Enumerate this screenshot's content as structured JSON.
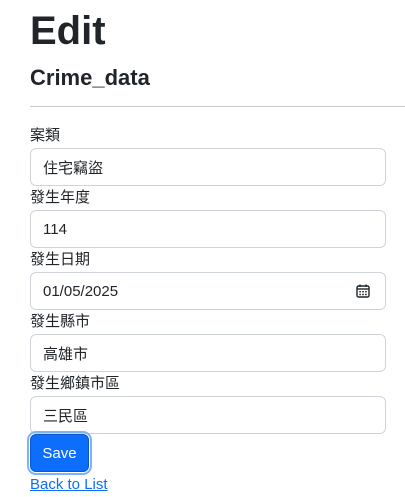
{
  "header": {
    "title": "Edit",
    "subtitle": "Crime_data"
  },
  "form": {
    "fields": [
      {
        "label": "案類",
        "value": "住宅竊盜"
      },
      {
        "label": "發生年度",
        "value": "114"
      },
      {
        "label": "發生日期",
        "value": "01/05/2025",
        "icon": "calendar-icon"
      },
      {
        "label": "發生縣市",
        "value": "高雄市"
      },
      {
        "label": "發生鄉鎮市區",
        "value": "三民區"
      }
    ],
    "save_label": "Save"
  },
  "links": {
    "back_label": "Back to List"
  },
  "colors": {
    "primary": "#0d6efd",
    "border": "#ced4da",
    "text": "#212529"
  }
}
